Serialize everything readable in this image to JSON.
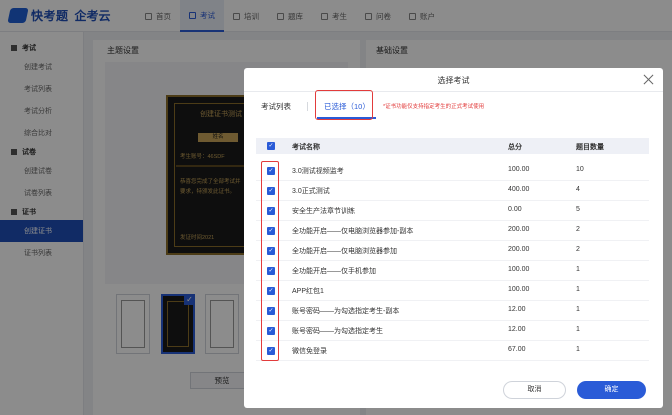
{
  "brand": {
    "name": "快考题",
    "sub": "企考云"
  },
  "nav": [
    {
      "label": "首页",
      "active": false
    },
    {
      "label": "考试",
      "active": true
    },
    {
      "label": "培训",
      "active": false
    },
    {
      "label": "题库",
      "active": false
    },
    {
      "label": "考生",
      "active": false
    },
    {
      "label": "问卷",
      "active": false
    },
    {
      "label": "账户",
      "active": false
    }
  ],
  "sidebar": [
    {
      "group": "考试",
      "items": [
        "创建考试",
        "考试列表",
        "考试分析",
        "综合比对"
      ]
    },
    {
      "group": "试卷",
      "items": [
        "创建试卷",
        "试卷列表"
      ]
    },
    {
      "group": "证书",
      "items": [
        "创建证书",
        "证书列表"
      ]
    }
  ],
  "sidebar_active": "创建证书",
  "background": {
    "left_title": "主题设置",
    "right_title": "基础设置",
    "cert_title": "创建证书测试",
    "cert_badge": "姓名",
    "cert_account": "考生账号：46SDF",
    "cert_body_1": "恭喜您完成了全部考试并",
    "cert_body_2": "要求，特颁发此证书。",
    "cert_date": "发证时间2021",
    "preview_label": "预览"
  },
  "modal": {
    "title": "选择考试",
    "tab_list": "考试列表",
    "tab_selected": "已选择（10）",
    "note": "*证书功能仅支持指定考生的正式考试使用",
    "columns": [
      "考试名称",
      "总分",
      "题目数量"
    ],
    "rows": [
      {
        "name": "3.0测试视频监考",
        "score": "100.00",
        "count": "10"
      },
      {
        "name": "3.0正式测试",
        "score": "400.00",
        "count": "4"
      },
      {
        "name": "安全生产法章节训练",
        "score": "0.00",
        "count": "5"
      },
      {
        "name": "全功能开启——仅电脑浏览器参加-副本",
        "score": "200.00",
        "count": "2"
      },
      {
        "name": "全功能开启——仅电脑浏览器参加",
        "score": "200.00",
        "count": "2"
      },
      {
        "name": "全功能开启——仅手机参加",
        "score": "100.00",
        "count": "1"
      },
      {
        "name": "APP红包1",
        "score": "100.00",
        "count": "1"
      },
      {
        "name": "账号密码——为勾选指定考生-副本",
        "score": "12.00",
        "count": "1"
      },
      {
        "name": "账号密码——为勾选指定考生",
        "score": "12.00",
        "count": "1"
      },
      {
        "name": "微信免登录",
        "score": "67.00",
        "count": "1"
      }
    ],
    "cancel_label": "取消",
    "ok_label": "确定"
  },
  "colors": {
    "accent": "#2a5bd7",
    "highlight": "#e23b3b"
  }
}
